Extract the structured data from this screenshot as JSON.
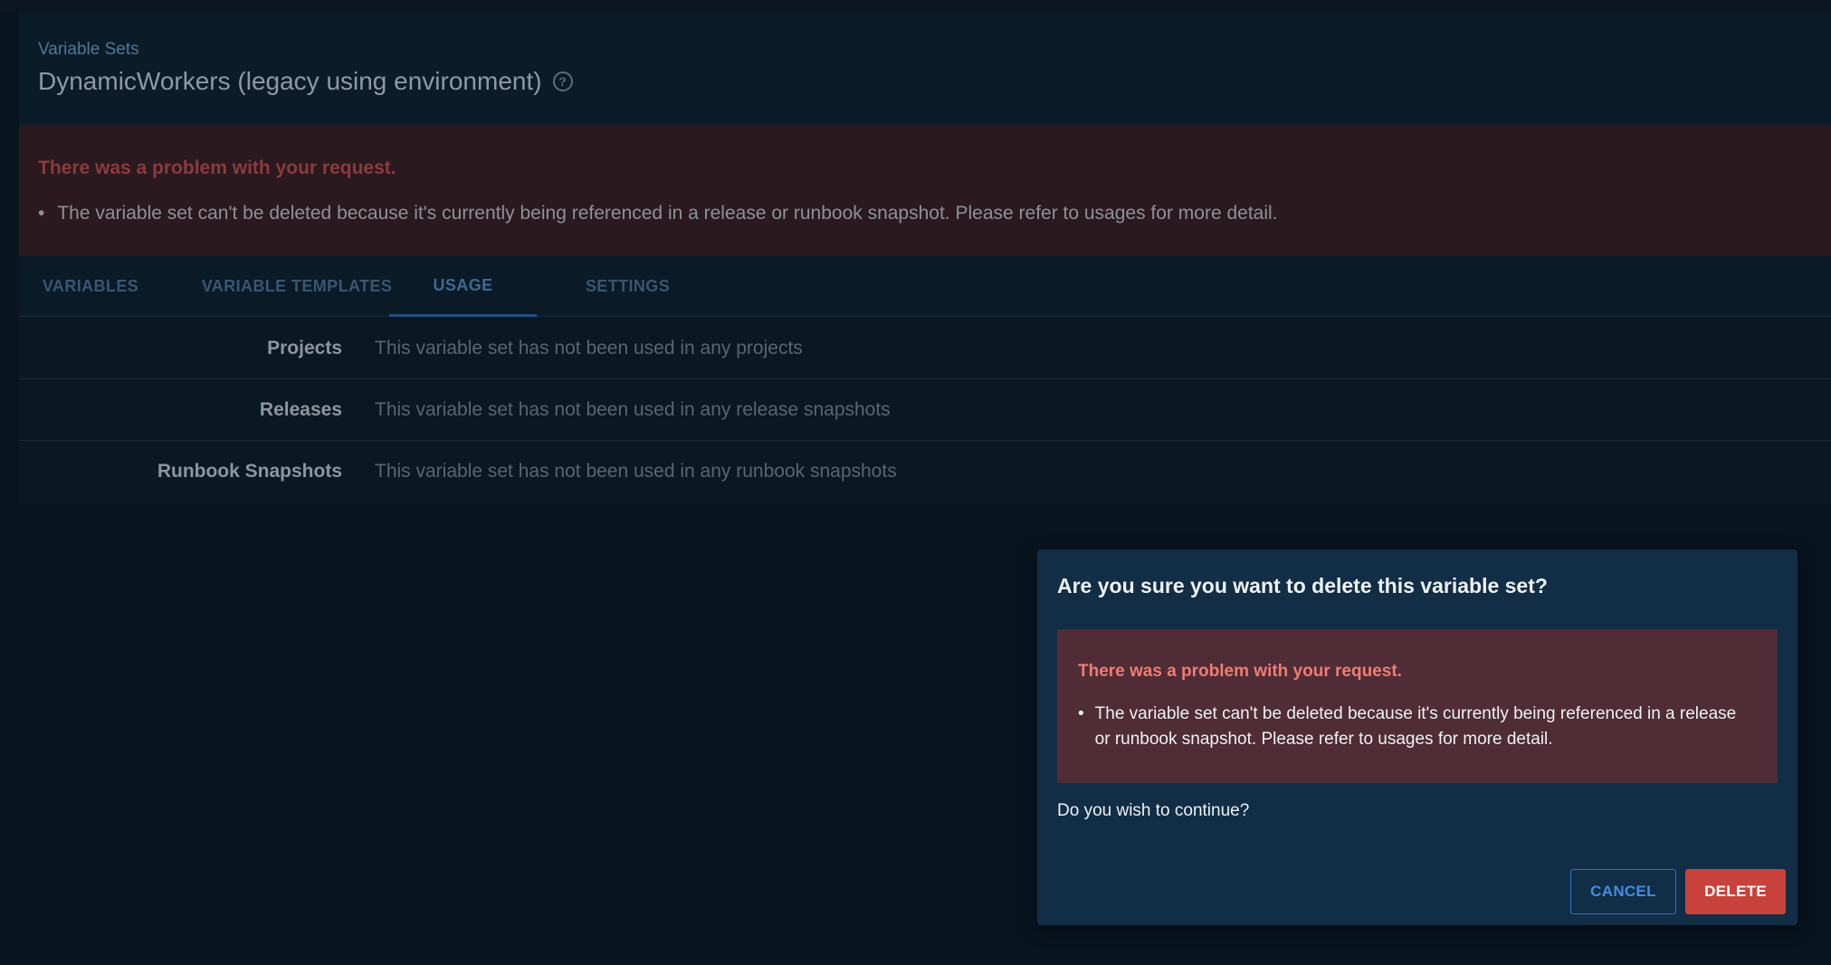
{
  "header": {
    "breadcrumb": "Variable Sets",
    "title": "DynamicWorkers (legacy using environment)",
    "help_icon": "question-circle-icon"
  },
  "error_banner": {
    "title": "There was a problem with your request.",
    "message": "The variable set can't be deleted because it's currently being referenced in a release or runbook snapshot. Please refer to usages for more detail."
  },
  "tabs": [
    {
      "label": "VARIABLES",
      "active": false
    },
    {
      "label": "VARIABLE TEMPLATES",
      "active": false
    },
    {
      "label": "USAGE",
      "active": true
    },
    {
      "label": "SETTINGS",
      "active": false
    }
  ],
  "usage": {
    "rows": [
      {
        "label": "Projects",
        "value": "This variable set has not been used in any projects"
      },
      {
        "label": "Releases",
        "value": "This variable set has not been used in any release snapshots"
      },
      {
        "label": "Runbook Snapshots",
        "value": "This variable set has not been used in any runbook snapshots"
      }
    ]
  },
  "dialog": {
    "title": "Are you sure you want to delete this variable set?",
    "error_title": "There was a problem with your request.",
    "error_message": "The variable set can't be deleted because it's currently being referenced in a release or runbook snapshot. Please refer to usages for more detail.",
    "question": "Do you wish to continue?",
    "cancel_label": "CANCEL",
    "delete_label": "DELETE"
  },
  "colors": {
    "background": "#08141f",
    "dialog_background": "#122d46",
    "error_background": "#4f2c36",
    "delete_button": "#c8423b",
    "accent_blue": "#3f8fe0"
  }
}
